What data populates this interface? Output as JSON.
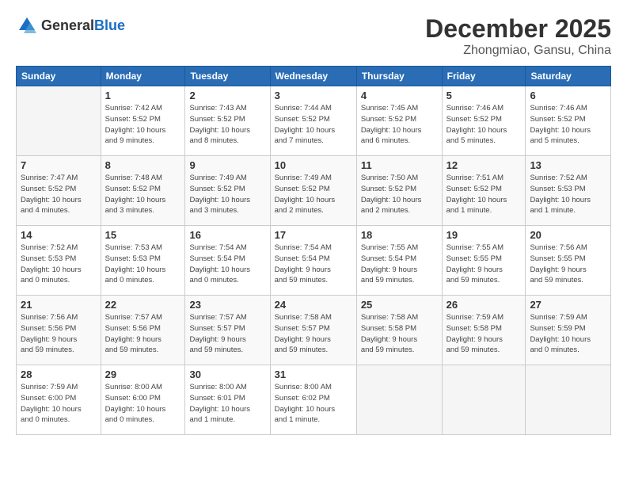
{
  "header": {
    "logo_general": "General",
    "logo_blue": "Blue",
    "month": "December 2025",
    "location": "Zhongmiao, Gansu, China"
  },
  "days_of_week": [
    "Sunday",
    "Monday",
    "Tuesday",
    "Wednesday",
    "Thursday",
    "Friday",
    "Saturday"
  ],
  "weeks": [
    [
      {
        "day": "",
        "info": ""
      },
      {
        "day": "1",
        "info": "Sunrise: 7:42 AM\nSunset: 5:52 PM\nDaylight: 10 hours\nand 9 minutes."
      },
      {
        "day": "2",
        "info": "Sunrise: 7:43 AM\nSunset: 5:52 PM\nDaylight: 10 hours\nand 8 minutes."
      },
      {
        "day": "3",
        "info": "Sunrise: 7:44 AM\nSunset: 5:52 PM\nDaylight: 10 hours\nand 7 minutes."
      },
      {
        "day": "4",
        "info": "Sunrise: 7:45 AM\nSunset: 5:52 PM\nDaylight: 10 hours\nand 6 minutes."
      },
      {
        "day": "5",
        "info": "Sunrise: 7:46 AM\nSunset: 5:52 PM\nDaylight: 10 hours\nand 5 minutes."
      },
      {
        "day": "6",
        "info": "Sunrise: 7:46 AM\nSunset: 5:52 PM\nDaylight: 10 hours\nand 5 minutes."
      }
    ],
    [
      {
        "day": "7",
        "info": "Sunrise: 7:47 AM\nSunset: 5:52 PM\nDaylight: 10 hours\nand 4 minutes."
      },
      {
        "day": "8",
        "info": "Sunrise: 7:48 AM\nSunset: 5:52 PM\nDaylight: 10 hours\nand 3 minutes."
      },
      {
        "day": "9",
        "info": "Sunrise: 7:49 AM\nSunset: 5:52 PM\nDaylight: 10 hours\nand 3 minutes."
      },
      {
        "day": "10",
        "info": "Sunrise: 7:49 AM\nSunset: 5:52 PM\nDaylight: 10 hours\nand 2 minutes."
      },
      {
        "day": "11",
        "info": "Sunrise: 7:50 AM\nSunset: 5:52 PM\nDaylight: 10 hours\nand 2 minutes."
      },
      {
        "day": "12",
        "info": "Sunrise: 7:51 AM\nSunset: 5:52 PM\nDaylight: 10 hours\nand 1 minute."
      },
      {
        "day": "13",
        "info": "Sunrise: 7:52 AM\nSunset: 5:53 PM\nDaylight: 10 hours\nand 1 minute."
      }
    ],
    [
      {
        "day": "14",
        "info": "Sunrise: 7:52 AM\nSunset: 5:53 PM\nDaylight: 10 hours\nand 0 minutes."
      },
      {
        "day": "15",
        "info": "Sunrise: 7:53 AM\nSunset: 5:53 PM\nDaylight: 10 hours\nand 0 minutes."
      },
      {
        "day": "16",
        "info": "Sunrise: 7:54 AM\nSunset: 5:54 PM\nDaylight: 10 hours\nand 0 minutes."
      },
      {
        "day": "17",
        "info": "Sunrise: 7:54 AM\nSunset: 5:54 PM\nDaylight: 9 hours\nand 59 minutes."
      },
      {
        "day": "18",
        "info": "Sunrise: 7:55 AM\nSunset: 5:54 PM\nDaylight: 9 hours\nand 59 minutes."
      },
      {
        "day": "19",
        "info": "Sunrise: 7:55 AM\nSunset: 5:55 PM\nDaylight: 9 hours\nand 59 minutes."
      },
      {
        "day": "20",
        "info": "Sunrise: 7:56 AM\nSunset: 5:55 PM\nDaylight: 9 hours\nand 59 minutes."
      }
    ],
    [
      {
        "day": "21",
        "info": "Sunrise: 7:56 AM\nSunset: 5:56 PM\nDaylight: 9 hours\nand 59 minutes."
      },
      {
        "day": "22",
        "info": "Sunrise: 7:57 AM\nSunset: 5:56 PM\nDaylight: 9 hours\nand 59 minutes."
      },
      {
        "day": "23",
        "info": "Sunrise: 7:57 AM\nSunset: 5:57 PM\nDaylight: 9 hours\nand 59 minutes."
      },
      {
        "day": "24",
        "info": "Sunrise: 7:58 AM\nSunset: 5:57 PM\nDaylight: 9 hours\nand 59 minutes."
      },
      {
        "day": "25",
        "info": "Sunrise: 7:58 AM\nSunset: 5:58 PM\nDaylight: 9 hours\nand 59 minutes."
      },
      {
        "day": "26",
        "info": "Sunrise: 7:59 AM\nSunset: 5:58 PM\nDaylight: 9 hours\nand 59 minutes."
      },
      {
        "day": "27",
        "info": "Sunrise: 7:59 AM\nSunset: 5:59 PM\nDaylight: 10 hours\nand 0 minutes."
      }
    ],
    [
      {
        "day": "28",
        "info": "Sunrise: 7:59 AM\nSunset: 6:00 PM\nDaylight: 10 hours\nand 0 minutes."
      },
      {
        "day": "29",
        "info": "Sunrise: 8:00 AM\nSunset: 6:00 PM\nDaylight: 10 hours\nand 0 minutes."
      },
      {
        "day": "30",
        "info": "Sunrise: 8:00 AM\nSunset: 6:01 PM\nDaylight: 10 hours\nand 1 minute."
      },
      {
        "day": "31",
        "info": "Sunrise: 8:00 AM\nSunset: 6:02 PM\nDaylight: 10 hours\nand 1 minute."
      },
      {
        "day": "",
        "info": ""
      },
      {
        "day": "",
        "info": ""
      },
      {
        "day": "",
        "info": ""
      }
    ]
  ]
}
